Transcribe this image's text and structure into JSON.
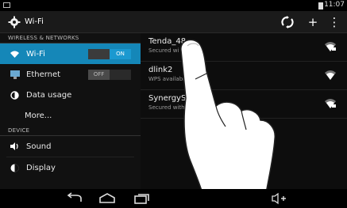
{
  "status_bar": {
    "time": "11:07"
  },
  "action_bar": {
    "title": "Wi-Fi",
    "add_label": "+",
    "overflow_label": "⋮"
  },
  "left_pane": {
    "sections": [
      {
        "header": "WIRELESS & NETWORKS",
        "items": [
          {
            "label": "Wi-Fi",
            "icon": "wifi-icon",
            "toggle": "ON",
            "selected": true
          },
          {
            "label": "Ethernet",
            "icon": "monitor-icon",
            "toggle": "OFF"
          },
          {
            "label": "Data usage",
            "icon": "data-usage-icon"
          },
          {
            "label": "More..."
          }
        ]
      },
      {
        "header": "DEVICE",
        "items": [
          {
            "label": "Sound",
            "icon": "speaker-icon"
          },
          {
            "label": "Display",
            "icon": "brightness-icon"
          }
        ]
      }
    ]
  },
  "networks": [
    {
      "ssid": "Tenda_48",
      "security": "Secured wi",
      "secured": true
    },
    {
      "ssid": "dlink2",
      "security": "WPS availabl",
      "secured": false
    },
    {
      "ssid": "SynergySZ",
      "security": "Secured with W",
      "secured": true
    }
  ],
  "colors": {
    "accent": "#1587b8",
    "toggle_on": "#1b99d0",
    "background": "#0b0b0b"
  }
}
